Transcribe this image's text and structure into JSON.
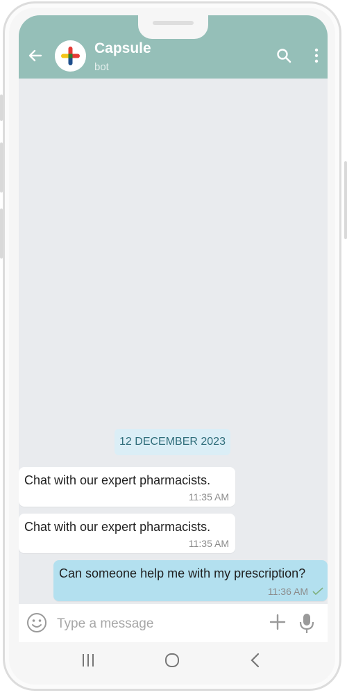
{
  "header": {
    "title": "Capsule",
    "subtitle": "bot",
    "color": "#95bfb8",
    "icons": [
      "back-arrow-icon",
      "capsule-logo-icon",
      "search-icon",
      "more-vertical-icon"
    ]
  },
  "chat": {
    "date_divider": "12 DECEMBER 2023",
    "messages": [
      {
        "direction": "incoming",
        "text": "Chat with our expert pharmacists.",
        "time": "11:35 AM"
      },
      {
        "direction": "incoming",
        "text": "Chat with our expert pharmacists.",
        "time": "11:35 AM"
      },
      {
        "direction": "outgoing",
        "text": "Can someone help me with my prescription?",
        "time": "11:36 AM",
        "status": "sent"
      }
    ]
  },
  "input": {
    "placeholder": "Type a message",
    "icons": [
      "emoji-icon",
      "plus-icon",
      "microphone-icon"
    ]
  },
  "nav": {
    "icons": [
      "recent-apps-icon",
      "home-icon",
      "back-icon"
    ]
  }
}
